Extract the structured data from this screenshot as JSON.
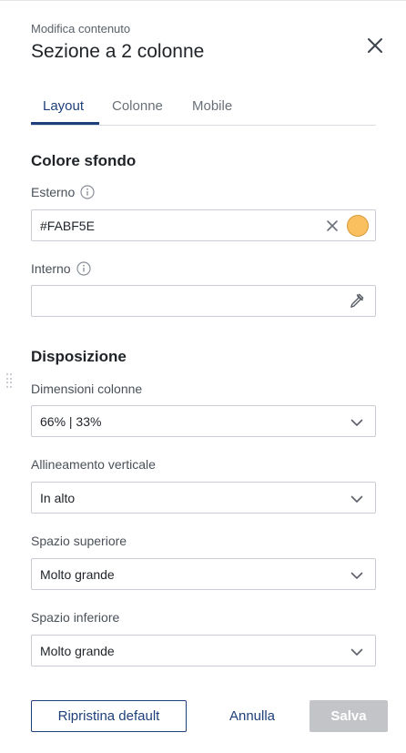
{
  "header": {
    "subtitle": "Modifica contenuto",
    "title": "Sezione a 2 colonne",
    "close_icon": "close-icon"
  },
  "tabs": [
    {
      "label": "Layout",
      "active": true
    },
    {
      "label": "Colonne",
      "active": false
    },
    {
      "label": "Mobile",
      "active": false
    }
  ],
  "colore_sfondo": {
    "section_title": "Colore sfondo",
    "esterno": {
      "label": "Esterno",
      "value": "#FABF5E",
      "swatch_color": "#FABF5E",
      "info_icon": "info-icon",
      "clear_icon": "clear-icon"
    },
    "interno": {
      "label": "Interno",
      "value": "",
      "info_icon": "info-icon",
      "picker_icon": "eyedropper-icon"
    }
  },
  "disposizione": {
    "section_title": "Disposizione",
    "dimensioni": {
      "label": "Dimensioni colonne",
      "value": "66% | 33%"
    },
    "allineamento": {
      "label": "Allineamento verticale",
      "value": "In alto"
    },
    "spazio_superiore": {
      "label": "Spazio superiore",
      "value": "Molto grande"
    },
    "spazio_inferiore": {
      "label": "Spazio inferiore",
      "value": "Molto grande"
    }
  },
  "footer": {
    "reset_label": "Ripristina default",
    "cancel_label": "Annulla",
    "save_label": "Salva"
  },
  "colors": {
    "accent": "#1E3F7A",
    "disabled_button": "#C3C4C7"
  }
}
